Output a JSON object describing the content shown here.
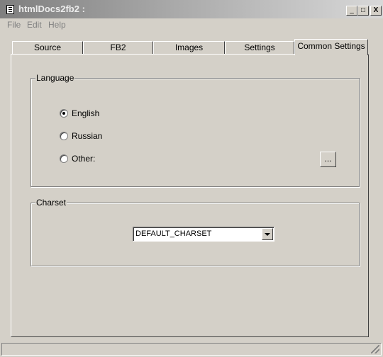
{
  "window": {
    "title": "htmlDocs2fb2 :",
    "controls": {
      "minimize": "_",
      "maximize": "□",
      "close": "X"
    }
  },
  "menu": [
    "File",
    "Edit",
    "Help"
  ],
  "tabs": [
    {
      "label": "Source",
      "active": false
    },
    {
      "label": "FB2",
      "active": false
    },
    {
      "label": "Images",
      "active": false
    },
    {
      "label": "Settings",
      "active": false
    },
    {
      "label": "Common Settings",
      "active": true
    }
  ],
  "language": {
    "group_label": "Language",
    "options": [
      {
        "label": "English",
        "checked": true
      },
      {
        "label": "Russian",
        "checked": false
      },
      {
        "label": "Other:",
        "checked": false
      }
    ],
    "browse_label": "..."
  },
  "charset": {
    "group_label": "Charset",
    "selected": "DEFAULT_CHARSET"
  },
  "icons": {
    "app": "app-document-icon",
    "combo_arrow": "chevron-down-icon",
    "resize": "resize-grip-icon"
  }
}
